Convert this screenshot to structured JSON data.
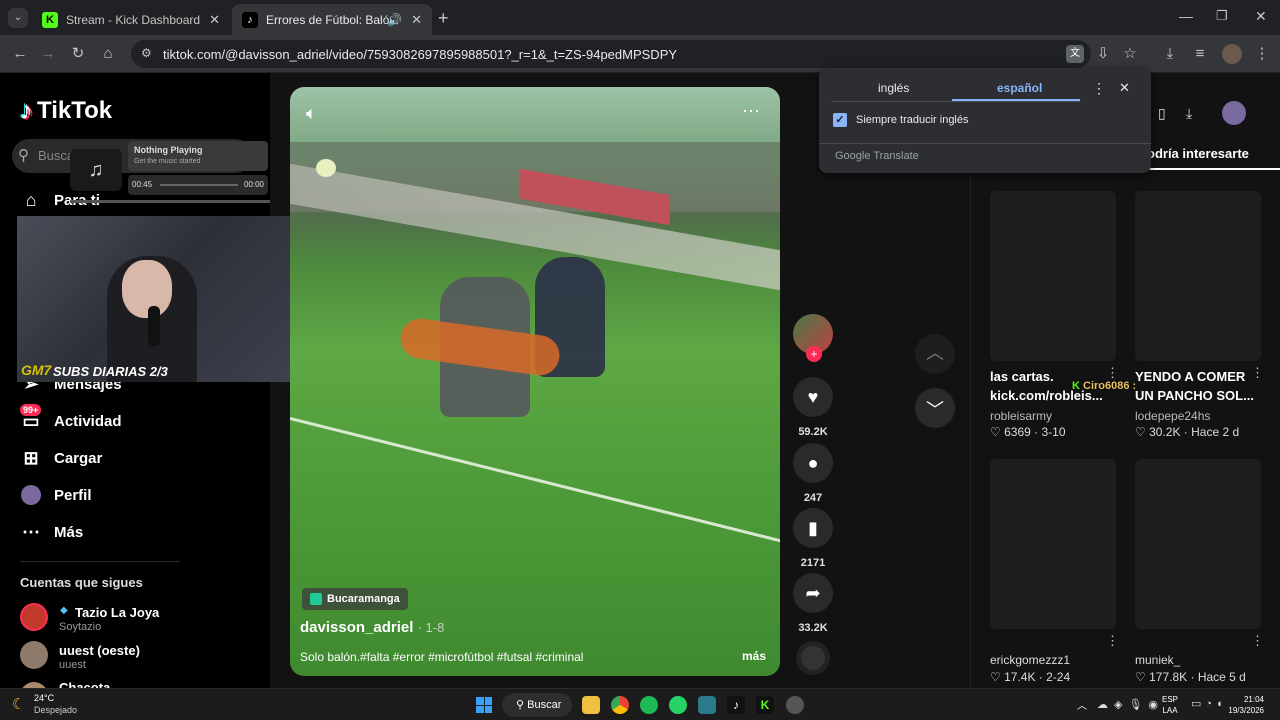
{
  "browser": {
    "tabs": [
      {
        "title": "Stream - Kick Dashboard",
        "favicon": "kick-icon",
        "color": "#53fc18"
      },
      {
        "title": "Errores de Fútbol: Balón qu",
        "favicon": "tiktok-icon",
        "color": "#000000"
      }
    ],
    "url": "tiktok.com/@davisson_adriel/video/7593082697895988501?_r=1&_t=ZS-94pedMPSDPY"
  },
  "translate": {
    "tab_en": "inglés",
    "tab_es": "español",
    "checkbox_label": "Siempre traducir inglés",
    "footer": "Google Translate"
  },
  "sidebar": {
    "logo": "TikTok",
    "search_placeholder": "Buscar",
    "items": [
      {
        "label": "Para ti",
        "icon": "home-icon"
      },
      {
        "label": "Mensajes",
        "icon": "messages-icon"
      },
      {
        "label": "Actividad",
        "icon": "activity-icon",
        "badge": "99+"
      },
      {
        "label": "Cargar",
        "icon": "upload-icon"
      },
      {
        "label": "Perfil",
        "icon": "profile-icon"
      },
      {
        "label": "Más",
        "icon": "more-icon"
      }
    ],
    "following_title": "Cuentas que sigues",
    "following": [
      {
        "name": "Tazio La Joya",
        "handle": "Soytazio"
      },
      {
        "name": "uuest (oeste)",
        "handle": "uuest"
      },
      {
        "name": "Chacota",
        "handle": ""
      }
    ]
  },
  "overlay": {
    "music_title": "Nothing Playing",
    "music_sub": "Get the music started",
    "time_start": "00:45",
    "time_end": "00:00",
    "subs_text": "SUBS DIARIAS 2/3",
    "logo": "GM7"
  },
  "video": {
    "location": "Bucaramanga",
    "author": "davisson_adriel",
    "date": "· 1-8",
    "caption": "Solo balón.#falta #error #microfútbol #futsal #criminal",
    "more": "más"
  },
  "actions": {
    "likes": "59.2K",
    "comments": "247",
    "saves": "2171",
    "shares": "33.2K"
  },
  "recommend": {
    "title": "odría interesarte",
    "chat_overlay": "Ciro6086 :",
    "cards": [
      {
        "title": "las cartas. kick.com/robleis...",
        "author": "robleisarmy",
        "likes": "6369",
        "date": "3-10"
      },
      {
        "title": "YENDO A COMER UN PANCHO SOL...",
        "author": "lodepepe24hs",
        "likes": "30.2K",
        "date": "Hace 2 d"
      },
      {
        "title": "",
        "author": "erickgomezzz1",
        "likes": "17.4K",
        "date": "2-24"
      },
      {
        "title": "",
        "author": "muniek_",
        "likes": "177.8K",
        "date": "Hace 5 d"
      }
    ]
  },
  "taskbar": {
    "weather_temp": "24°C",
    "weather_desc": "Despejado",
    "search_label": "Buscar",
    "lang": "ESP",
    "lang2": "LAA",
    "time": "21:04",
    "date": "19/3/2026"
  }
}
